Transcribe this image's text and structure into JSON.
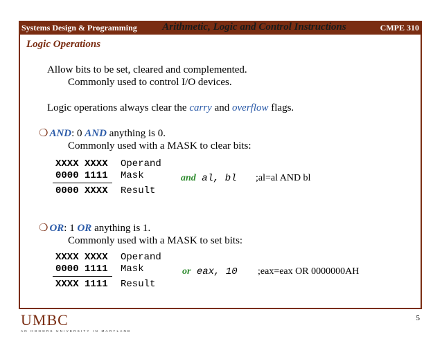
{
  "header": {
    "left": "Systems Design & Programming",
    "center": "Arithmetic, Logic and Control Instructions",
    "right": "CMPE 310",
    "color": "#7a2d12"
  },
  "section_title": "Logic Operations",
  "intro": {
    "line1": "Allow bits to be set, cleared and complemented.",
    "line2": "Commonly used to control I/O devices.",
    "line3_pre": "Logic operations always clear the ",
    "line3_carry": "carry",
    "line3_mid": " and ",
    "line3_overflow": "overflow",
    "line3_post": " flags."
  },
  "and_block": {
    "bullet_glyph": "❍",
    "keyword": "AND",
    "text_mid": ": 0 ",
    "keyword2": "AND",
    "text_post": " anything is 0.",
    "desc": "Commonly used with a MASK to clear bits:",
    "rows": [
      {
        "bits": "XXXX XXXX",
        "label": "Operand"
      },
      {
        "bits": "0000 1111",
        "label": "Mask"
      },
      {
        "bits": "0000 XXXX",
        "label": "Result"
      }
    ],
    "instr_op": "and",
    "instr_args": " al, bl",
    "instr_comment": ";al=al AND bl"
  },
  "or_block": {
    "bullet_glyph": "❍",
    "keyword": "OR",
    "text_mid": ": 1 ",
    "keyword2": "OR",
    "text_post": " anything is 1.",
    "desc": "Commonly used with a MASK to set bits:",
    "rows": [
      {
        "bits": "XXXX XXXX",
        "label": "Operand"
      },
      {
        "bits": "0000 1111",
        "label": "Mask"
      },
      {
        "bits": "XXXX 1111",
        "label": "Result"
      }
    ],
    "instr_op": "or",
    "instr_args": " eax, 10",
    "instr_comment": ";eax=eax OR 0000000AH"
  },
  "footer": {
    "logo": "UMBC",
    "tagline": "AN HONORS UNIVERSITY IN MARYLAND",
    "page": "5"
  }
}
